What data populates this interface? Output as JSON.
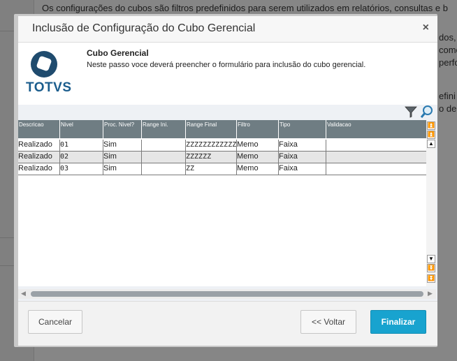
{
  "background": {
    "line1": "Os configurações do cubos são filtros predefinidos para serem utilizados em relatórios, consultas e b",
    "frag1": "dos,",
    "frag2": "come",
    "frag3": "perfo",
    "frag4": "efini",
    "frag5": "o de"
  },
  "dialog": {
    "title": "Inclusão de Configuração do Cubo Gerencial",
    "close_label": "×"
  },
  "info": {
    "logo_text": "TOTVS",
    "heading": "Cubo Gerencial",
    "description": "Neste passo voce deverá preencher o formulário para inclusão do cubo gerencial."
  },
  "toolbar": {
    "filter_icon": "filter-icon",
    "search_icon": "search-icon"
  },
  "grid": {
    "columns": [
      "Descricao",
      "Nivel",
      "Proc. Nivel?",
      "Range Ini.",
      "Range Final",
      "Filtro",
      "Tipo",
      "Validacao"
    ],
    "rows": [
      [
        "Realizado",
        "01",
        "Sim",
        "",
        "ZZZZZZZZZZZZ",
        "Memo",
        "Faixa",
        ""
      ],
      [
        "Realizado",
        "02",
        "Sim",
        "",
        "ZZZZZZ",
        "Memo",
        "Faixa",
        ""
      ],
      [
        "Realizado",
        "03",
        "Sim",
        "",
        "ZZ",
        "Memo",
        "Faixa",
        ""
      ]
    ]
  },
  "footer": {
    "cancel_label": "Cancelar",
    "back_label": "<< Voltar",
    "finish_label": "Finalizar"
  },
  "colors": {
    "primary_button": "#18a3cf",
    "grid_header": "#6f7d83",
    "logo_blue": "#1b5d8d"
  }
}
